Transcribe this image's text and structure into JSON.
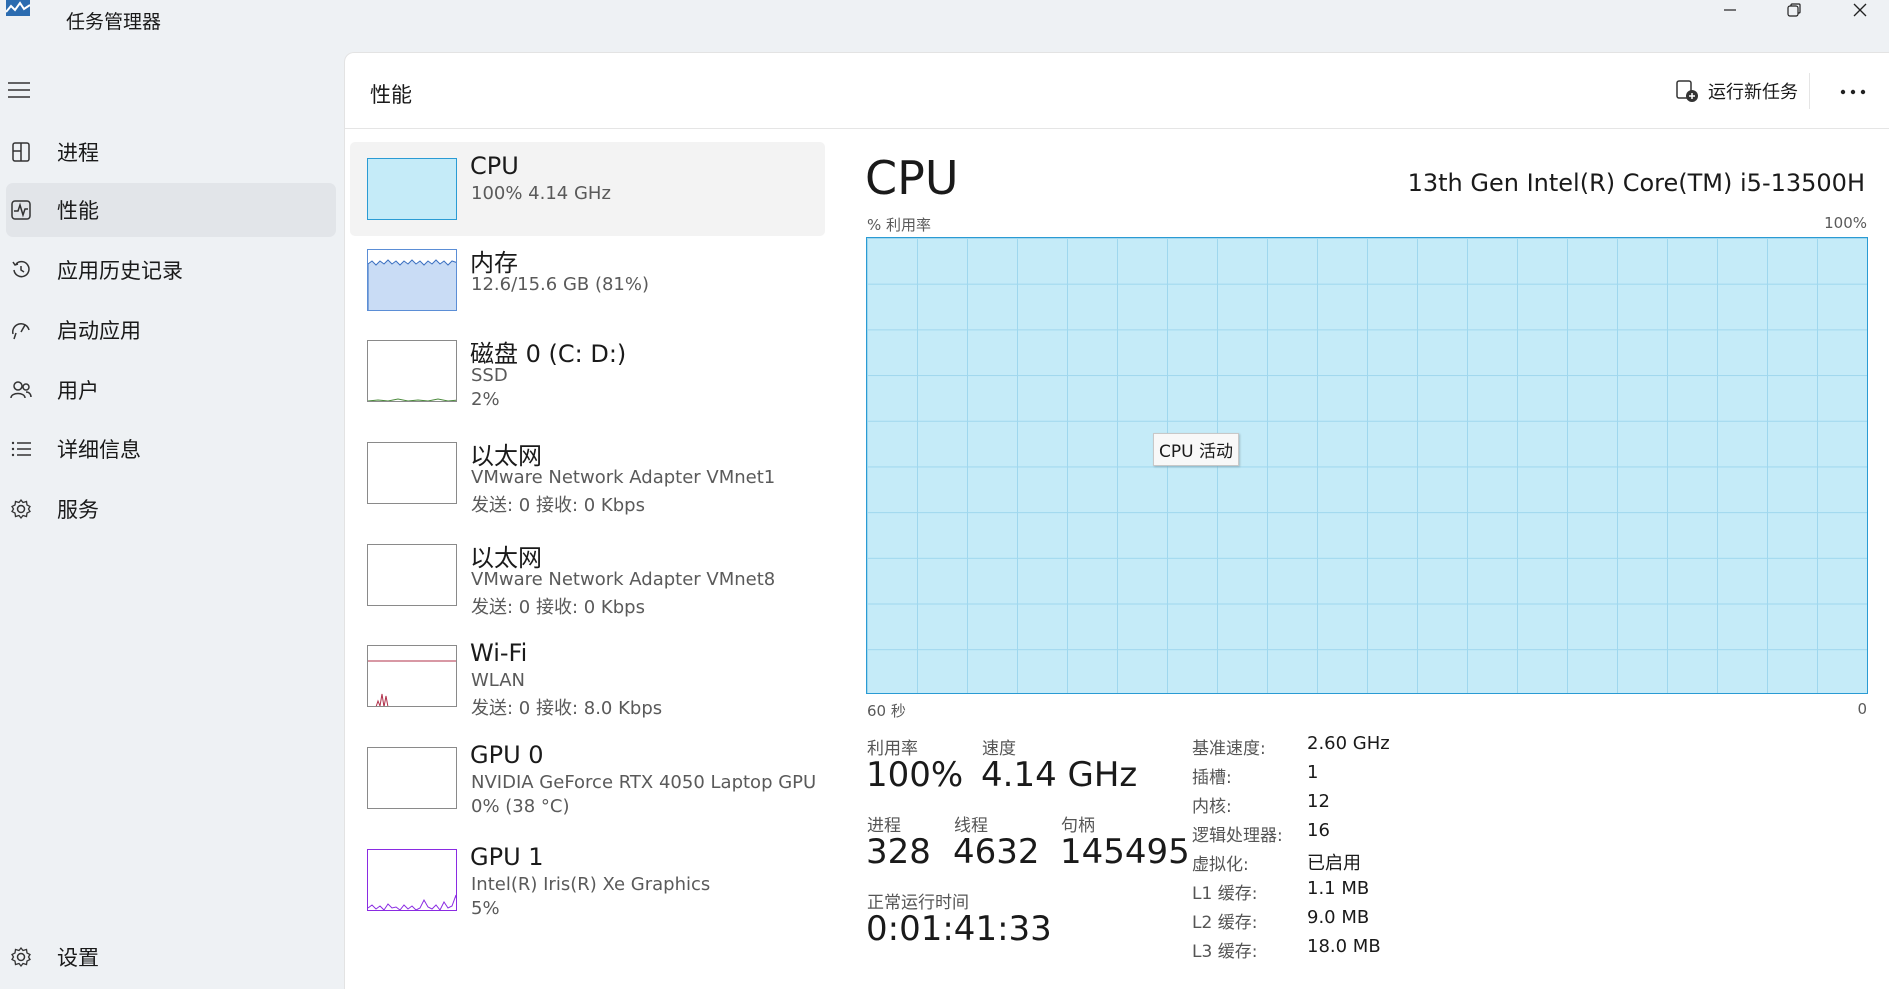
{
  "window": {
    "title": "任务管理器"
  },
  "sidebar": {
    "items": [
      {
        "label": "进程",
        "icon": "processes-icon"
      },
      {
        "label": "性能",
        "icon": "performance-icon",
        "active": true
      },
      {
        "label": "应用历史记录",
        "icon": "history-icon"
      },
      {
        "label": "启动应用",
        "icon": "startup-icon"
      },
      {
        "label": "用户",
        "icon": "users-icon"
      },
      {
        "label": "详细信息",
        "icon": "details-icon"
      },
      {
        "label": "服务",
        "icon": "services-icon"
      }
    ],
    "settings_label": "设置"
  },
  "header": {
    "title": "性能",
    "run_task_label": "运行新任务"
  },
  "resources": [
    {
      "name": "CPU",
      "line1": "100%  4.14 GHz",
      "line2": ""
    },
    {
      "name": "内存",
      "line1": "12.6/15.6 GB (81%)",
      "line2": ""
    },
    {
      "name": "磁盘 0 (C: D:)",
      "line1": "SSD",
      "line2": "2%"
    },
    {
      "name": "以太网",
      "line1": "VMware Network Adapter VMnet1",
      "line2": "发送: 0 接收: 0 Kbps"
    },
    {
      "name": "以太网",
      "line1": "VMware Network Adapter VMnet8",
      "line2": "发送: 0 接收: 0 Kbps"
    },
    {
      "name": "Wi-Fi",
      "line1": "WLAN",
      "line2": "发送: 0 接收: 8.0 Kbps"
    },
    {
      "name": "GPU 0",
      "line1": "NVIDIA GeForce RTX 4050 Laptop GPU",
      "line2": "0%  (38 °C)"
    },
    {
      "name": "GPU 1",
      "line1": "Intel(R) Iris(R) Xe Graphics",
      "line2": "5%"
    }
  ],
  "detail": {
    "title": "CPU",
    "model": "13th Gen Intel(R) Core(TM) i5-13500H",
    "graph": {
      "y_label": "% 利用率",
      "y_max": "100%",
      "x_left": "60 秒",
      "x_right": "0",
      "tooltip": "CPU 活动",
      "utilization_percent": 100
    },
    "stats": {
      "utilization_label": "利用率",
      "utilization": "100%",
      "speed_label": "速度",
      "speed": "4.14 GHz",
      "processes_label": "进程",
      "processes": "328",
      "threads_label": "线程",
      "threads": "4632",
      "handles_label": "句柄",
      "handles": "145495",
      "uptime_label": "正常运行时间",
      "uptime": "0:01:41:33"
    },
    "info": [
      {
        "key": "基准速度:",
        "value": "2.60 GHz"
      },
      {
        "key": "插槽:",
        "value": "1"
      },
      {
        "key": "内核:",
        "value": "12"
      },
      {
        "key": "逻辑处理器:",
        "value": "16"
      },
      {
        "key": "虚拟化:",
        "value": "已启用"
      },
      {
        "key": "L1 缓存:",
        "value": "1.1 MB"
      },
      {
        "key": "L2 缓存:",
        "value": "9.0 MB"
      },
      {
        "key": "L3 缓存:",
        "value": "18.0 MB"
      }
    ]
  },
  "colors": {
    "graph_fill": "#c5ebf8",
    "graph_border": "#2a9bd4",
    "memory_fill": "#c9dcf5",
    "wifi_line": "#b0304a",
    "gpu_line": "#8a2be2"
  }
}
